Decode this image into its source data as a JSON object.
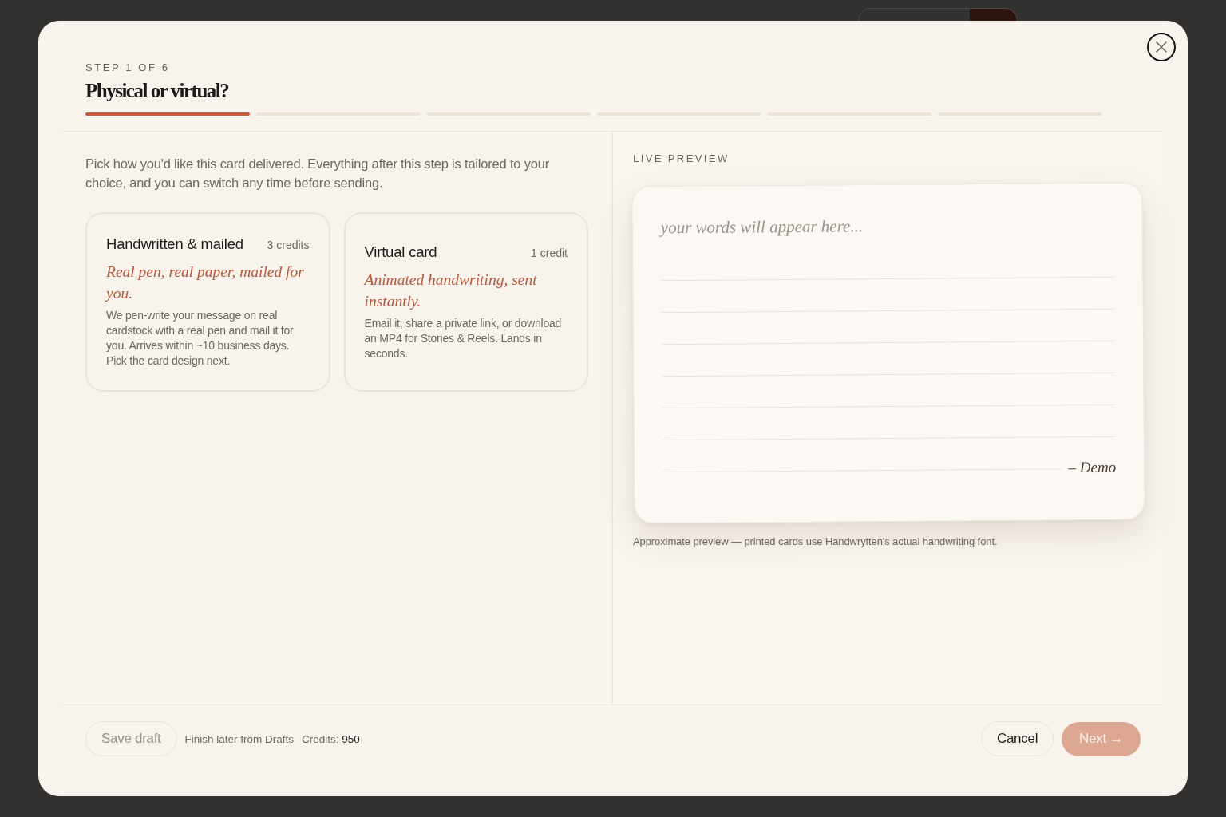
{
  "dialog": {
    "step_label": "STEP 1 OF 6",
    "title": "Physical or virtual?",
    "progress": [
      {
        "done": true
      },
      {
        "done": false
      },
      {
        "done": false
      },
      {
        "done": false
      },
      {
        "done": false
      },
      {
        "done": false
      }
    ]
  },
  "intro": "Pick how you'd like this card delivered. Everything after this step is tailored to your choice, and you can switch any time before sending.",
  "options": [
    {
      "title": "Handwritten & mailed",
      "price": "3 credits",
      "tagline": "Real pen, real paper, mailed for you.",
      "description": "We pen-write your message on real cardstock with a real pen and mail it for you. Arrives within ~10 business days. Pick the card design next.",
      "selected": false
    },
    {
      "title": "Virtual card",
      "price": "1 credit",
      "tagline": "Animated handwriting, sent instantly.",
      "description": "Email it, share a private link, or download an MP4 for Stories & Reels. Lands in seconds.",
      "selected": false
    }
  ],
  "preview": {
    "heading": "LIVE PREVIEW",
    "empty_message": "your words will appear here...",
    "signature": "– Demo",
    "caption": "Approximate preview — printed cards use Handwrytten's actual handwriting font."
  },
  "footer": {
    "save_draft": {
      "label": "Save draft",
      "disabled": true
    },
    "hint": "Finish later from Drafts",
    "credits_label": "Credits:",
    "credits_value": "950",
    "cancel": {
      "label": "Cancel",
      "disabled": false
    },
    "next": {
      "label": "Next →",
      "disabled": true
    }
  }
}
